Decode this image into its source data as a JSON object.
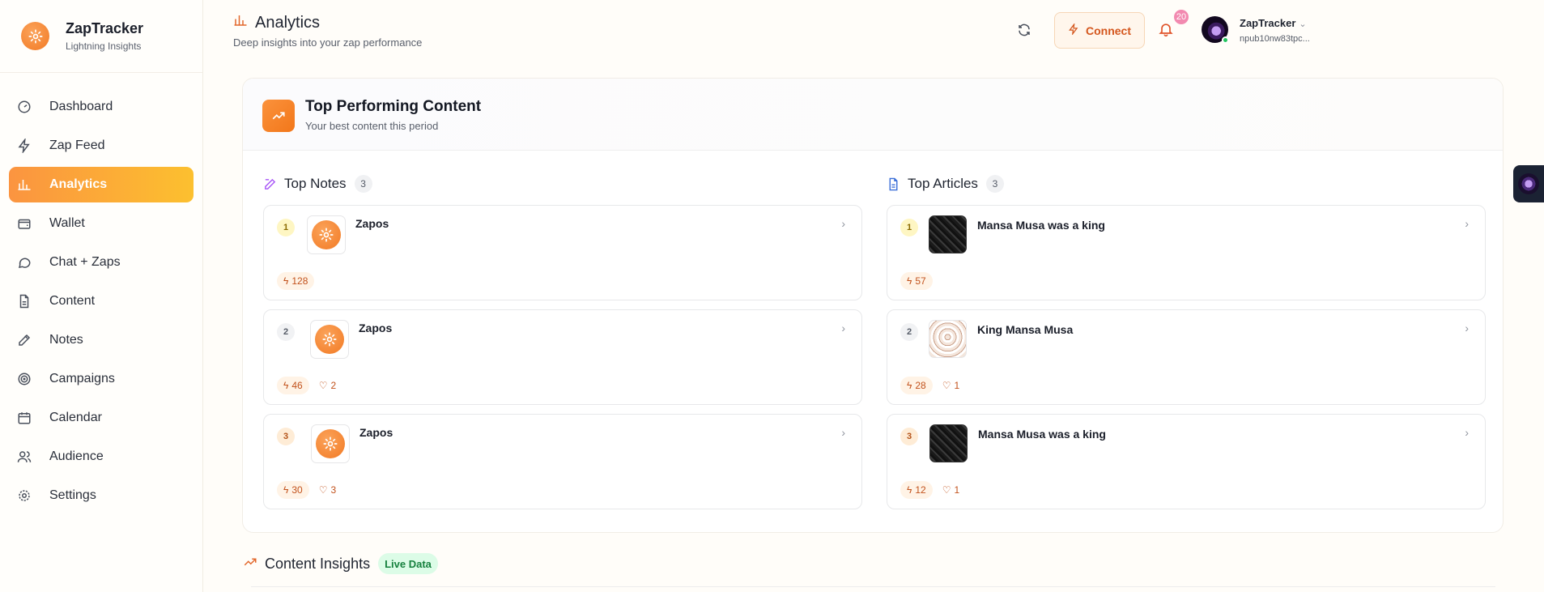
{
  "brand": {
    "name": "ZapTracker",
    "tagline": "Lightning Insights"
  },
  "sidebar": {
    "items": [
      {
        "label": "Dashboard",
        "icon": "gauge-icon"
      },
      {
        "label": "Zap Feed",
        "icon": "zap-icon"
      },
      {
        "label": "Analytics",
        "icon": "bar-chart-icon",
        "active": true
      },
      {
        "label": "Wallet",
        "icon": "wallet-icon"
      },
      {
        "label": "Chat + Zaps",
        "icon": "chat-icon"
      },
      {
        "label": "Content",
        "icon": "file-icon"
      },
      {
        "label": "Notes",
        "icon": "pencil-icon"
      },
      {
        "label": "Campaigns",
        "icon": "target-icon"
      },
      {
        "label": "Calendar",
        "icon": "calendar-icon"
      },
      {
        "label": "Audience",
        "icon": "users-icon"
      },
      {
        "label": "Settings",
        "icon": "gear-icon"
      }
    ]
  },
  "header": {
    "title": "Analytics",
    "subtitle": "Deep insights into your zap performance",
    "connect_label": "Connect",
    "notification_count": "20",
    "user_name": "ZapTracker",
    "user_key": "npub10nw83tpc..."
  },
  "top_content": {
    "title": "Top Performing Content",
    "subtitle": "Your best content this period",
    "notes": {
      "label": "Top Notes",
      "count": "3",
      "items": [
        {
          "rank": "1",
          "title": "Zapos",
          "zaps": "128",
          "likes": ""
        },
        {
          "rank": "2",
          "title": "Zapos",
          "zaps": "46",
          "likes": "2"
        },
        {
          "rank": "3",
          "title": "Zapos",
          "zaps": "30",
          "likes": "3"
        }
      ]
    },
    "articles": {
      "label": "Top Articles",
      "count": "3",
      "items": [
        {
          "rank": "1",
          "title": "Mansa Musa was a king",
          "zaps": "57",
          "likes": ""
        },
        {
          "rank": "2",
          "title": "King Mansa Musa",
          "zaps": "28",
          "likes": "1"
        },
        {
          "rank": "3",
          "title": "Mansa Musa was a king",
          "zaps": "12",
          "likes": "1"
        }
      ]
    }
  },
  "insights": {
    "title": "Content Insights",
    "badge": "Live Data"
  },
  "colors": {
    "accent": "#f27a24",
    "active_gradient_start": "#fb9440",
    "active_gradient_end": "#fcc02f",
    "live_green": "#15803d"
  }
}
